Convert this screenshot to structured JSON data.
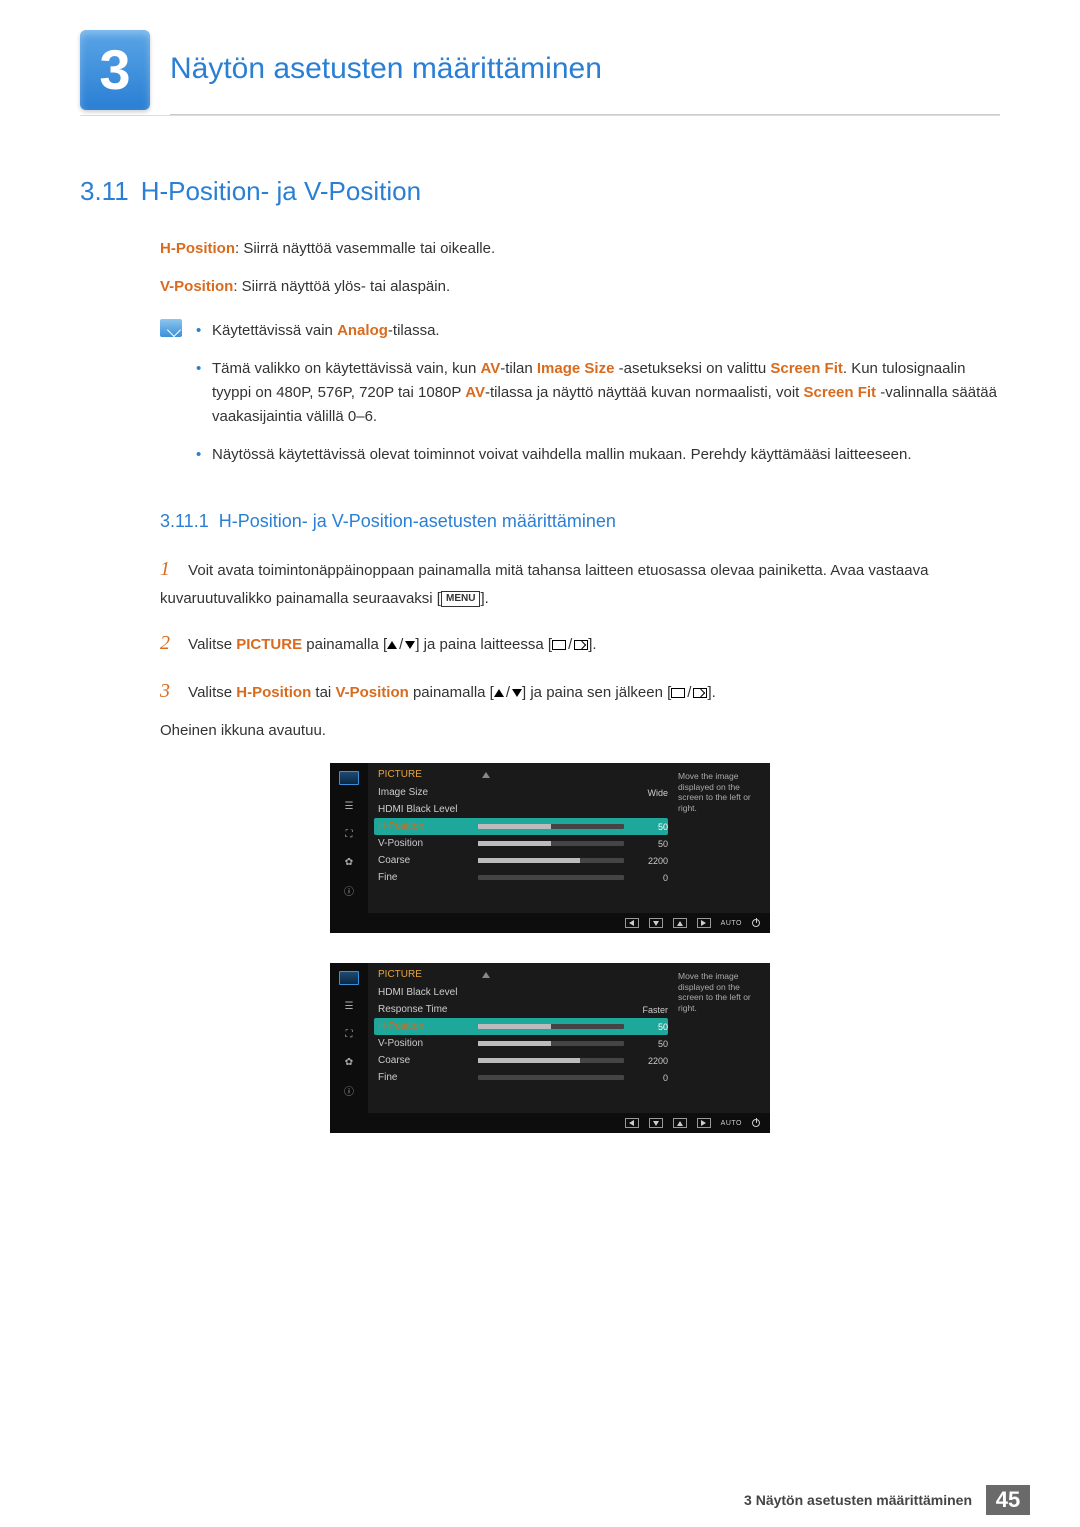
{
  "header": {
    "chapter_num": "3",
    "chapter_title": "Näytön asetusten määrittäminen"
  },
  "section": {
    "num": "3.11",
    "title": "H-Position- ja V-Position"
  },
  "definitions": {
    "hpos_label": "H-Position",
    "hpos_text": ": Siirrä näyttöä vasemmalle tai oikealle.",
    "vpos_label": "V-Position",
    "vpos_text": ": Siirrä näyttöä ylös- tai alaspäin."
  },
  "notes": {
    "n1_a": "Käytettävissä vain ",
    "n1_b": "Analog",
    "n1_c": "-tilassa.",
    "n2_a": "Tämä valikko on käytettävissä vain, kun ",
    "n2_b": "AV",
    "n2_c": "-tilan ",
    "n2_d": "Image Size",
    "n2_e": " -asetukseksi on valittu ",
    "n2_f": "Screen Fit",
    "n2_g": ". Kun tulosignaalin tyyppi on 480P, 576P, 720P tai 1080P ",
    "n2_h": "AV",
    "n2_i": "-tilassa ja näyttö näyttää kuvan normaalisti, voit ",
    "n2_j": "Screen Fit",
    "n2_k": " -valinnalla säätää vaakasijaintia välillä 0–6.",
    "n3": "Näytössä käytettävissä olevat toiminnot voivat vaihdella mallin mukaan. Perehdy käyttämääsi laitteeseen."
  },
  "subsection": {
    "num": "3.11.1",
    "title": "H-Position- ja V-Position-asetusten määrittäminen"
  },
  "steps": {
    "s1_num": "1",
    "s1": "Voit avata toimintonäppäinoppaan painamalla mitä tahansa laitteen etuosassa olevaa painiketta. Avaa vastaava kuvaruutuvalikko painamalla seuraavaksi [",
    "s1_menu": "MENU",
    "s1_end": "].",
    "s2_num": "2",
    "s2_a": "Valitse ",
    "s2_b": "PICTURE",
    "s2_c": " painamalla [",
    "s2_d": "] ja paina laitteessa [",
    "s2_e": "].",
    "s3_num": "3",
    "s3_a": "Valitse ",
    "s3_b": "H-Position",
    "s3_c": " tai ",
    "s3_d": "V-Position",
    "s3_e": " painamalla [",
    "s3_f": "] ja paina sen jälkeen [",
    "s3_g": "].",
    "s3_after": "Oheinen ikkuna avautuu."
  },
  "osd1": {
    "title": "PICTURE",
    "help": "Move the image displayed on the screen to the left or right.",
    "rows": [
      {
        "label": "Image Size",
        "value": "Wide",
        "bar": null
      },
      {
        "label": "HDMI Black Level",
        "value": "",
        "bar": null
      },
      {
        "label": "H-Position",
        "value": "50",
        "bar": 50,
        "selected": true
      },
      {
        "label": "V-Position",
        "value": "50",
        "bar": 50
      },
      {
        "label": "Coarse",
        "value": "2200",
        "bar": 70
      },
      {
        "label": "Fine",
        "value": "0",
        "bar": 0
      }
    ],
    "footer_auto": "AUTO"
  },
  "osd2": {
    "title": "PICTURE",
    "help": "Move the image displayed on the screen to the left or right.",
    "rows": [
      {
        "label": "HDMI Black Level",
        "value": "",
        "bar": null
      },
      {
        "label": "Response Time",
        "value": "Faster",
        "bar": null
      },
      {
        "label": "H-Position",
        "value": "50",
        "bar": 50,
        "selected": true
      },
      {
        "label": "V-Position",
        "value": "50",
        "bar": 50
      },
      {
        "label": "Coarse",
        "value": "2200",
        "bar": 70
      },
      {
        "label": "Fine",
        "value": "0",
        "bar": 0
      }
    ],
    "footer_auto": "AUTO"
  },
  "footer": {
    "crumb": "3 Näytön asetusten määrittäminen",
    "page": "45"
  }
}
